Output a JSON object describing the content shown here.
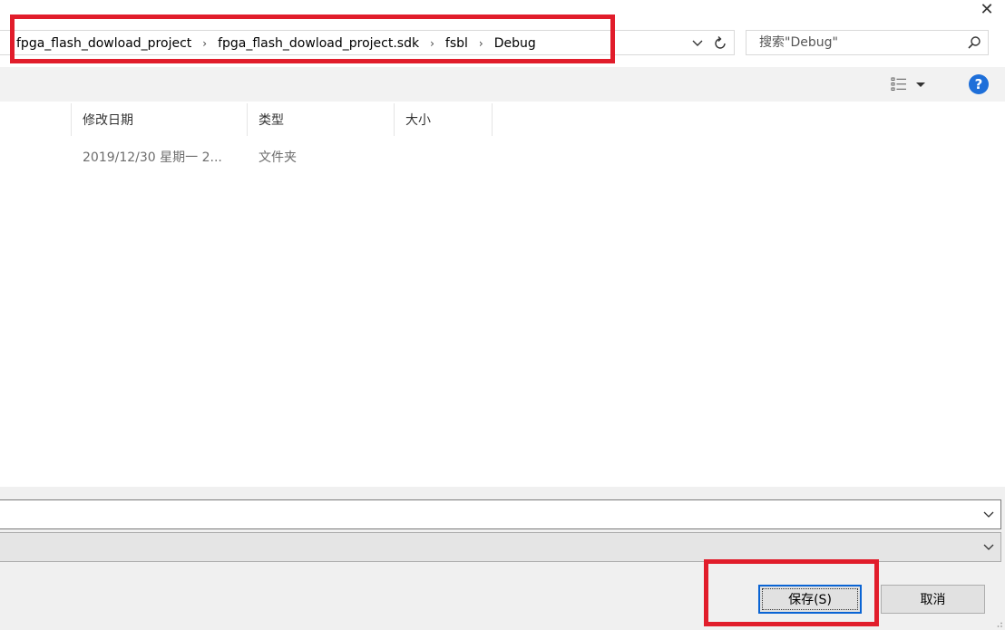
{
  "window": {
    "close_glyph": "✕"
  },
  "breadcrumb": {
    "items": [
      "fpga_flash_dowload_project",
      "fpga_flash_dowload_project.sdk",
      "fsbl",
      "Debug"
    ],
    "separator": "›"
  },
  "search": {
    "placeholder": "搜索\"Debug\""
  },
  "toolbar": {
    "view_icon": "view-options-icon",
    "help_label": "?"
  },
  "columns": {
    "date": "修改日期",
    "type": "类型",
    "size": "大小"
  },
  "files": [
    {
      "date": "2019/12/30 星期一 2...",
      "type": "文件夹",
      "size": ""
    }
  ],
  "footer": {
    "filename_value": "",
    "filetype_value": "",
    "save_label": "保存(S)",
    "cancel_label": "取消"
  },
  "colors": {
    "highlight": "#e11d2b",
    "accent": "#0a64d4",
    "help": "#1e6fd9"
  }
}
